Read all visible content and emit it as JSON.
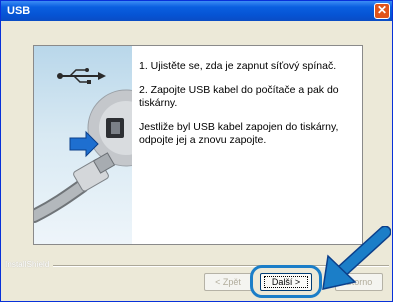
{
  "window": {
    "title": "USB"
  },
  "instructions": [
    "1. Ujistěte se, zda je zapnut síťový spínač.",
    "2. Zapojte USB kabel do počítače a pak do tiskárny.",
    "Jestliže byl USB kabel zapojen do tiskárny, odpojte jej a znovu zapojte."
  ],
  "footer": {
    "brand": "InstallShield"
  },
  "buttons": {
    "back": "< Zpět",
    "next": "Další >",
    "cancel": "Storno"
  },
  "colors": {
    "titlebar": "#0654d4",
    "highlight": "#1b7ec8"
  },
  "icons": [
    "close-icon",
    "usb-icon",
    "usb-plug-icon",
    "pointer-arrow-icon"
  ]
}
